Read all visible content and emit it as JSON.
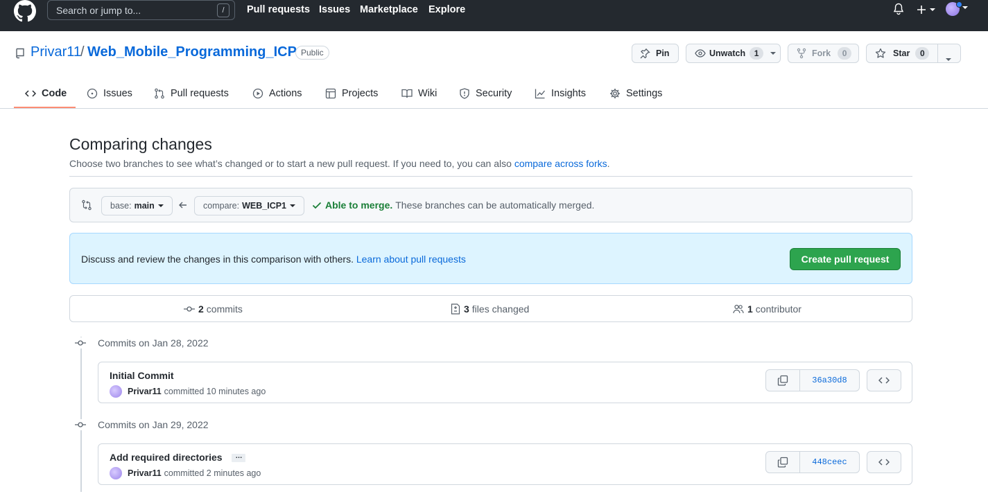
{
  "header": {
    "search_placeholder": "Search or jump to...",
    "search_shortcut": "/",
    "nav": [
      "Pull requests",
      "Issues",
      "Marketplace",
      "Explore"
    ]
  },
  "repo": {
    "owner": "Privar11",
    "separator": "/",
    "name": "Web_Mobile_Programming_ICP",
    "visibility": "Public",
    "pin_label": "Pin",
    "watch_label": "Unwatch",
    "watch_count": "1",
    "fork_label": "Fork",
    "fork_count": "0",
    "star_label": "Star",
    "star_count": "0"
  },
  "tabs": [
    "Code",
    "Issues",
    "Pull requests",
    "Actions",
    "Projects",
    "Wiki",
    "Security",
    "Insights",
    "Settings"
  ],
  "compare": {
    "title": "Comparing changes",
    "subtitle": "Choose two branches to see what’s changed or to start a new pull request. If you need to, you can also",
    "subtitle_link": "compare across forks",
    "subtitle_end": ".",
    "base_label": "base:",
    "base_branch": "main",
    "compare_label": "compare:",
    "compare_branch": "WEB_ICP1",
    "merge_status": "Able to merge.",
    "merge_detail": "These branches can be automatically merged."
  },
  "blankslate": {
    "text": "Discuss and review the changes in this comparison with others.",
    "link": "Learn about pull requests",
    "button": "Create pull request"
  },
  "summary": {
    "commits_count": "2",
    "commits_label": "commits",
    "files_count": "3",
    "files_label": "files changed",
    "contributors_count": "1",
    "contributors_label": "contributor"
  },
  "commit_groups": [
    {
      "date": "Commits on Jan 28, 2022",
      "title": "Initial Commit",
      "author": "Privar11",
      "meta": "committed 10 minutes ago",
      "sha": "36a30d8"
    },
    {
      "date": "Commits on Jan 29, 2022",
      "title": "Add required directories",
      "ellipsis": "…",
      "author": "Privar11",
      "meta": "committed 2 minutes ago",
      "sha": "448ceec"
    }
  ],
  "colors": {
    "header_bg": "#24292f",
    "link": "#0969da",
    "success": "#2da44e",
    "tab_underline": "#fd8c73",
    "info_bg": "#ddf4ff"
  }
}
